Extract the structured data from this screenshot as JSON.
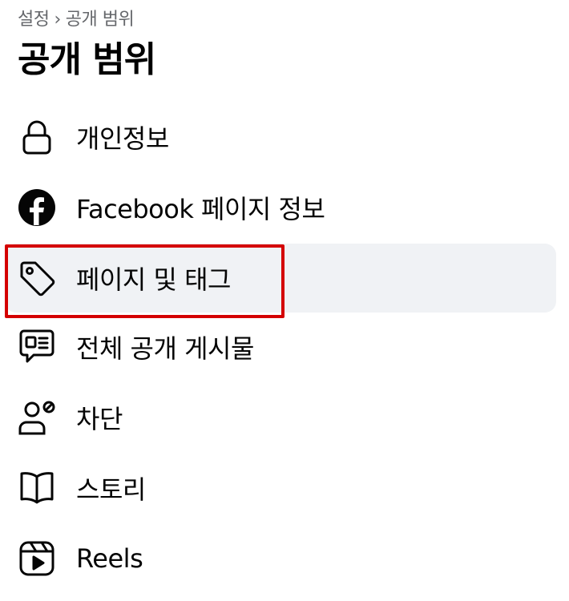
{
  "breadcrumb": {
    "parent": "설정",
    "separator": "›",
    "current": "공개 범위"
  },
  "page_title": "공개 범위",
  "menu": [
    {
      "label": "개인정보",
      "icon": "lock-icon"
    },
    {
      "label": "Facebook 페이지 정보",
      "icon": "facebook-icon"
    },
    {
      "label": "페이지 및 태그",
      "icon": "tag-icon",
      "selected": true
    },
    {
      "label": "전체 공개 게시물",
      "icon": "chat-bubble-icon"
    },
    {
      "label": "차단",
      "icon": "user-block-icon"
    },
    {
      "label": "스토리",
      "icon": "book-icon"
    },
    {
      "label": "Reels",
      "icon": "reels-icon"
    }
  ],
  "colors": {
    "highlight": "#d40000",
    "selected_bg": "#f0f2f5",
    "muted_text": "#65676b"
  }
}
